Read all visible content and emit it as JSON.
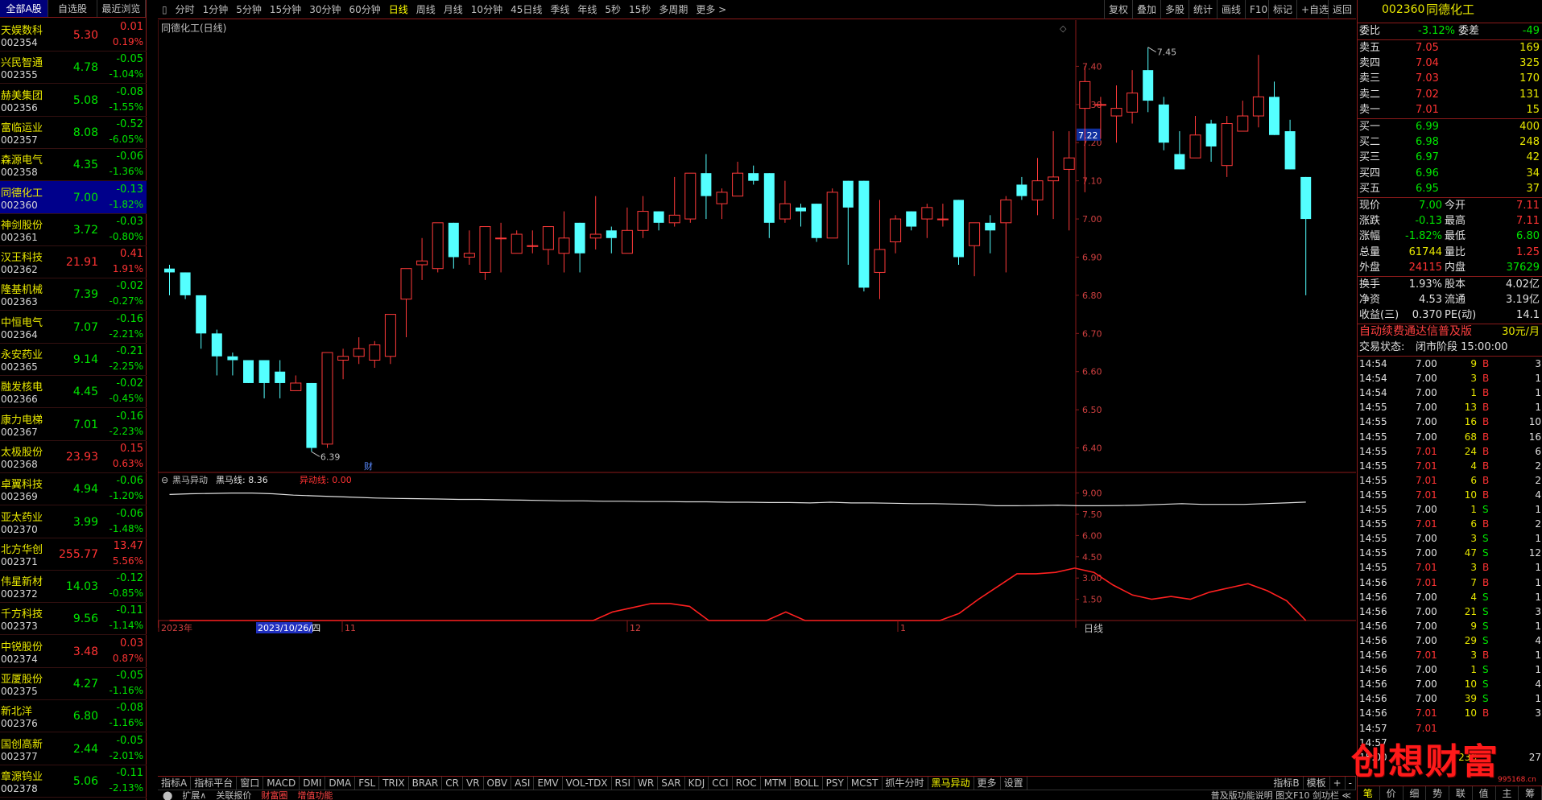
{
  "left_panel": {
    "tabs": [
      "全部A股",
      "自选股",
      "最近浏览"
    ],
    "stocks": [
      {
        "name": "天娱数科",
        "code": "002354",
        "price": "5.30",
        "change": "0.01",
        "pct": "0.19%",
        "dir": "up"
      },
      {
        "name": "兴民智通",
        "code": "002355",
        "price": "4.78",
        "change": "-0.05",
        "pct": "-1.04%",
        "dir": "dn"
      },
      {
        "name": "赫美集团",
        "code": "002356",
        "price": "5.08",
        "change": "-0.08",
        "pct": "-1.55%",
        "dir": "dn"
      },
      {
        "name": "富临运业",
        "code": "002357",
        "price": "8.08",
        "change": "-0.52",
        "pct": "-6.05%",
        "dir": "dn"
      },
      {
        "name": "森源电气",
        "code": "002358",
        "price": "4.35",
        "change": "-0.06",
        "pct": "-1.36%",
        "dir": "dn"
      },
      {
        "name": "同德化工",
        "code": "002360",
        "price": "7.00",
        "change": "-0.13",
        "pct": "-1.82%",
        "dir": "dn",
        "selected": true
      },
      {
        "name": "神剑股份",
        "code": "002361",
        "price": "3.72",
        "change": "-0.03",
        "pct": "-0.80%",
        "dir": "dn"
      },
      {
        "name": "汉王科技",
        "code": "002362",
        "price": "21.91",
        "change": "0.41",
        "pct": "1.91%",
        "dir": "up"
      },
      {
        "name": "隆基机械",
        "code": "002363",
        "price": "7.39",
        "change": "-0.02",
        "pct": "-0.27%",
        "dir": "dn"
      },
      {
        "name": "中恒电气",
        "code": "002364",
        "price": "7.07",
        "change": "-0.16",
        "pct": "-2.21%",
        "dir": "dn"
      },
      {
        "name": "永安药业",
        "code": "002365",
        "price": "9.14",
        "change": "-0.21",
        "pct": "-2.25%",
        "dir": "dn"
      },
      {
        "name": "融发核电",
        "code": "002366",
        "price": "4.45",
        "change": "-0.02",
        "pct": "-0.45%",
        "dir": "dn"
      },
      {
        "name": "康力电梯",
        "code": "002367",
        "price": "7.01",
        "change": "-0.16",
        "pct": "-2.23%",
        "dir": "dn"
      },
      {
        "name": "太极股份",
        "code": "002368",
        "price": "23.93",
        "change": "0.15",
        "pct": "0.63%",
        "dir": "up"
      },
      {
        "name": "卓翼科技",
        "code": "002369",
        "price": "4.94",
        "change": "-0.06",
        "pct": "-1.20%",
        "dir": "dn"
      },
      {
        "name": "亚太药业",
        "code": "002370",
        "price": "3.99",
        "change": "-0.06",
        "pct": "-1.48%",
        "dir": "dn"
      },
      {
        "name": "北方华创",
        "code": "002371",
        "price": "255.77",
        "change": "13.47",
        "pct": "5.56%",
        "dir": "up"
      },
      {
        "name": "伟星新材",
        "code": "002372",
        "price": "14.03",
        "change": "-0.12",
        "pct": "-0.85%",
        "dir": "dn"
      },
      {
        "name": "千方科技",
        "code": "002373",
        "price": "9.56",
        "change": "-0.11",
        "pct": "-1.14%",
        "dir": "dn"
      },
      {
        "name": "中锐股份",
        "code": "002374",
        "price": "3.48",
        "change": "0.03",
        "pct": "0.87%",
        "dir": "up"
      },
      {
        "name": "亚厦股份",
        "code": "002375",
        "price": "4.27",
        "change": "-0.05",
        "pct": "-1.16%",
        "dir": "dn"
      },
      {
        "name": "新北洋",
        "code": "002376",
        "price": "6.80",
        "change": "-0.08",
        "pct": "-1.16%",
        "dir": "dn"
      },
      {
        "name": "国创高新",
        "code": "002377",
        "price": "2.44",
        "change": "-0.05",
        "pct": "-2.01%",
        "dir": "dn"
      },
      {
        "name": "章源钨业",
        "code": "002378",
        "price": "5.06",
        "change": "-0.11",
        "pct": "-2.13%",
        "dir": "dn"
      }
    ]
  },
  "toolbar": {
    "periods": [
      "分时",
      "1分钟",
      "5分钟",
      "15分钟",
      "30分钟",
      "60分钟",
      "日线",
      "周线",
      "月线",
      "10分钟",
      "45日线",
      "季线",
      "年线",
      "5秒",
      "15秒",
      "多周期",
      "更多 >"
    ],
    "active_period": "日线",
    "right_buttons": [
      "复权",
      "叠加",
      "多股",
      "统计",
      "画线",
      "F10",
      "标记",
      "+自选",
      "返回"
    ]
  },
  "chart": {
    "title": "同德化工(日线)",
    "high_label": "7.45",
    "low_label": "6.39",
    "price_axis": [
      "7.40",
      "7.30",
      "7.20",
      "7.10",
      "7.00",
      "6.90",
      "6.80",
      "6.70",
      "6.60",
      "6.50",
      "6.40"
    ],
    "current_price_tag": "7.22",
    "cai_mark": "财",
    "indicator_name": "黑马异动",
    "indicator_line1": "黑马线: 8.36",
    "indicator_line2": "异动线: 0.00",
    "indicator_axis": [
      "9.00",
      "7.50",
      "6.00",
      "4.50",
      "3.00",
      "1.50"
    ],
    "date_labels": [
      "2023年",
      "2023/10/26/四",
      "11",
      "12",
      "1"
    ],
    "period_label": "日线",
    "cursor_date": "2023/10/26/四",
    "chart_data": {
      "type": "candlestick",
      "ylim": [
        6.34,
        7.5
      ],
      "candles": [
        [
          6.87,
          6.86,
          6.88,
          6.8
        ],
        [
          6.86,
          6.8,
          6.86,
          6.79
        ],
        [
          6.8,
          6.7,
          6.8,
          6.66
        ],
        [
          6.7,
          6.64,
          6.71,
          6.59
        ],
        [
          6.64,
          6.63,
          6.65,
          6.59
        ],
        [
          6.63,
          6.57,
          6.63,
          6.57
        ],
        [
          6.63,
          6.57,
          6.63,
          6.53
        ],
        [
          6.6,
          6.57,
          6.63,
          6.53
        ],
        [
          6.55,
          6.57,
          6.59,
          6.55
        ],
        [
          6.57,
          6.4,
          6.57,
          6.39
        ],
        [
          6.41,
          6.65,
          6.65,
          6.4
        ],
        [
          6.63,
          6.64,
          6.66,
          6.58
        ],
        [
          6.64,
          6.66,
          6.69,
          6.62
        ],
        [
          6.63,
          6.67,
          6.68,
          6.61
        ],
        [
          6.64,
          6.75,
          6.75,
          6.62
        ],
        [
          6.79,
          6.87,
          6.87,
          6.69
        ],
        [
          6.88,
          6.89,
          6.95,
          6.84
        ],
        [
          6.87,
          6.99,
          6.99,
          6.86
        ],
        [
          6.99,
          6.9,
          6.99,
          6.87
        ],
        [
          6.9,
          6.91,
          6.97,
          6.88
        ],
        [
          6.86,
          6.98,
          6.98,
          6.84
        ],
        [
          6.95,
          6.95,
          6.99,
          6.86
        ],
        [
          6.91,
          6.96,
          6.97,
          6.92
        ],
        [
          6.93,
          6.93,
          6.97,
          6.91
        ],
        [
          6.92,
          6.98,
          6.98,
          6.88
        ],
        [
          6.91,
          6.95,
          7.02,
          6.86
        ],
        [
          6.99,
          6.91,
          6.99,
          6.86
        ],
        [
          6.95,
          6.96,
          7.06,
          6.92
        ],
        [
          6.97,
          6.95,
          6.98,
          6.91
        ],
        [
          6.91,
          6.97,
          7.03,
          6.91
        ],
        [
          6.97,
          7.02,
          7.06,
          6.95
        ],
        [
          7.02,
          6.99,
          7.02,
          6.97
        ],
        [
          6.99,
          7.01,
          7.11,
          6.98
        ],
        [
          7.0,
          7.12,
          7.12,
          6.99
        ],
        [
          7.12,
          7.06,
          7.17,
          7.0
        ],
        [
          7.04,
          7.07,
          7.08,
          7.0
        ],
        [
          7.06,
          7.12,
          7.15,
          7.06
        ],
        [
          7.12,
          7.1,
          7.14,
          7.09
        ],
        [
          7.12,
          6.99,
          7.12,
          6.95
        ],
        [
          7.0,
          7.04,
          7.1,
          6.99
        ],
        [
          7.03,
          7.02,
          7.04,
          6.98
        ],
        [
          7.04,
          6.95,
          7.04,
          6.94
        ],
        [
          6.95,
          7.07,
          7.08,
          6.95
        ],
        [
          7.1,
          7.03,
          7.1,
          6.88
        ],
        [
          7.1,
          6.82,
          7.1,
          6.81
        ],
        [
          6.86,
          6.92,
          7.05,
          6.79
        ],
        [
          6.94,
          7.0,
          7.01,
          6.91
        ],
        [
          7.02,
          6.98,
          7.02,
          6.97
        ],
        [
          7.0,
          7.03,
          7.04,
          6.95
        ],
        [
          7.0,
          7.0,
          7.04,
          6.98
        ],
        [
          7.05,
          6.9,
          7.05,
          6.88
        ],
        [
          6.93,
          6.99,
          6.99,
          6.85
        ],
        [
          6.99,
          6.97,
          7.01,
          6.91
        ],
        [
          6.99,
          7.05,
          7.06,
          6.86
        ],
        [
          7.09,
          7.06,
          7.11,
          7.05
        ],
        [
          7.05,
          7.1,
          7.16,
          7.01
        ],
        [
          7.1,
          7.11,
          7.23,
          7.0
        ],
        [
          7.13,
          7.16,
          7.23,
          6.97
        ],
        [
          7.29,
          7.36,
          7.4,
          7.07
        ],
        [
          7.3,
          7.3,
          7.32,
          7.21
        ],
        [
          7.27,
          7.29,
          7.35,
          7.2
        ],
        [
          7.28,
          7.33,
          7.39,
          7.25
        ],
        [
          7.39,
          7.31,
          7.45,
          7.28
        ],
        [
          7.3,
          7.2,
          7.32,
          7.18
        ],
        [
          7.17,
          7.13,
          7.23,
          7.13
        ],
        [
          7.16,
          7.22,
          7.27,
          7.16
        ],
        [
          7.25,
          7.19,
          7.26,
          7.15
        ],
        [
          7.14,
          7.25,
          7.27,
          7.11
        ],
        [
          7.23,
          7.27,
          7.31,
          7.23
        ],
        [
          7.27,
          7.32,
          7.43,
          7.24
        ],
        [
          7.32,
          7.22,
          7.36,
          7.22
        ],
        [
          7.23,
          7.13,
          7.26,
          7.13
        ],
        [
          7.11,
          7.0,
          7.11,
          6.8
        ]
      ],
      "indicator_white": [
        8.9,
        8.95,
        8.97,
        9.0,
        9.0,
        8.95,
        8.85,
        8.8,
        8.75,
        8.7,
        8.65,
        8.62,
        8.6,
        8.58,
        8.55,
        8.55,
        8.52,
        8.5,
        8.48,
        8.45,
        8.45,
        8.42,
        8.42,
        8.4,
        8.4,
        8.38,
        8.38,
        8.35,
        8.35,
        8.33,
        8.33,
        8.3,
        8.35,
        8.3,
        8.3,
        8.28,
        8.25,
        8.25,
        8.22,
        8.2,
        8.1,
        8.1,
        8.12,
        8.15,
        8.1,
        8.1,
        8.12,
        8.15,
        8.2,
        8.25,
        8.2,
        8.2,
        8.2,
        8.25,
        8.3,
        8.36
      ],
      "indicator_red": [
        0,
        0,
        0,
        0,
        0,
        0,
        0,
        0,
        0,
        0,
        0,
        0,
        0,
        0,
        0,
        0,
        0,
        0,
        0,
        0,
        0,
        0,
        0,
        0.6,
        0.9,
        1.2,
        1.2,
        1.0,
        0,
        0,
        0,
        0,
        0.6,
        0,
        0,
        0,
        0,
        0,
        0,
        0,
        0,
        0.5,
        1.5,
        2.4,
        3.3,
        3.3,
        3.4,
        3.7,
        3.4,
        2.5,
        1.8,
        1.5,
        1.7,
        1.5,
        2.0,
        2.3,
        2.6,
        2.1,
        1.4,
        0
      ]
    }
  },
  "right_panel": {
    "code": "002360",
    "name": "同德化工",
    "weibi_label": "委比",
    "weibi": "-3.12%",
    "weicha_label": "委差",
    "weicha": "-49",
    "sells": [
      {
        "label": "卖五",
        "price": "7.05",
        "vol": "169"
      },
      {
        "label": "卖四",
        "price": "7.04",
        "vol": "325"
      },
      {
        "label": "卖三",
        "price": "7.03",
        "vol": "170"
      },
      {
        "label": "卖二",
        "price": "7.02",
        "vol": "131"
      },
      {
        "label": "卖一",
        "price": "7.01",
        "vol": "15"
      }
    ],
    "buys": [
      {
        "label": "买一",
        "price": "6.99",
        "vol": "400"
      },
      {
        "label": "买二",
        "price": "6.98",
        "vol": "248"
      },
      {
        "label": "买三",
        "price": "6.97",
        "vol": "42"
      },
      {
        "label": "买四",
        "price": "6.96",
        "vol": "34"
      },
      {
        "label": "买五",
        "price": "6.95",
        "vol": "37"
      }
    ],
    "quotes": [
      {
        "l1": "现价",
        "v1": "7.00",
        "c1": "dn",
        "l2": "今开",
        "v2": "7.11",
        "c2": "up"
      },
      {
        "l1": "涨跌",
        "v1": "-0.13",
        "c1": "dn",
        "l2": "最高",
        "v2": "7.11",
        "c2": "up"
      },
      {
        "l1": "涨幅",
        "v1": "-1.82%",
        "c1": "dn",
        "l2": "最低",
        "v2": "6.80",
        "c2": "dn"
      },
      {
        "l1": "总量",
        "v1": "61744",
        "c1": "yw",
        "l2": "量比",
        "v2": "1.25",
        "c2": "up"
      },
      {
        "l1": "外盘",
        "v1": "24115",
        "c1": "up",
        "l2": "内盘",
        "v2": "37629",
        "c2": "dn"
      }
    ],
    "stats": [
      {
        "l1": "换手",
        "v1": "1.93%",
        "l2": "股本",
        "v2": "4.02亿"
      },
      {
        "l1": "净资",
        "v1": "4.53",
        "l2": "流通",
        "v2": "3.19亿"
      },
      {
        "l1": "收益(三)",
        "v1": "0.370",
        "l2": "PE(动)",
        "v2": "14.1"
      }
    ],
    "promo": "自动续费通达信普及版",
    "promo_price": "30元/月",
    "trade_status_label": "交易状态:",
    "trade_status": "闭市阶段 15:00:00",
    "ticks": [
      {
        "t": "14:54",
        "p": "7.00",
        "v": "9",
        "d": "B",
        "n": "3"
      },
      {
        "t": "14:54",
        "p": "7.00",
        "v": "3",
        "d": "B",
        "n": "1"
      },
      {
        "t": "14:54",
        "p": "7.00",
        "v": "1",
        "d": "B",
        "n": "1"
      },
      {
        "t": "14:55",
        "p": "7.00",
        "v": "13",
        "d": "B",
        "n": "1"
      },
      {
        "t": "14:55",
        "p": "7.00",
        "v": "16",
        "d": "B",
        "n": "10"
      },
      {
        "t": "14:55",
        "p": "7.00",
        "v": "68",
        "d": "B",
        "n": "16"
      },
      {
        "t": "14:55",
        "p": "7.01",
        "v": "24",
        "d": "B",
        "n": "6"
      },
      {
        "t": "14:55",
        "p": "7.01",
        "v": "4",
        "d": "B",
        "n": "2"
      },
      {
        "t": "14:55",
        "p": "7.01",
        "v": "6",
        "d": "B",
        "n": "2"
      },
      {
        "t": "14:55",
        "p": "7.01",
        "v": "10",
        "d": "B",
        "n": "4"
      },
      {
        "t": "14:55",
        "p": "7.00",
        "v": "1",
        "d": "S",
        "n": "1"
      },
      {
        "t": "14:55",
        "p": "7.01",
        "v": "6",
        "d": "B",
        "n": "2"
      },
      {
        "t": "14:55",
        "p": "7.00",
        "v": "3",
        "d": "S",
        "n": "1"
      },
      {
        "t": "14:55",
        "p": "7.00",
        "v": "47",
        "d": "S",
        "n": "12"
      },
      {
        "t": "14:55",
        "p": "7.01",
        "v": "3",
        "d": "B",
        "n": "1"
      },
      {
        "t": "14:56",
        "p": "7.01",
        "v": "7",
        "d": "B",
        "n": "1"
      },
      {
        "t": "14:56",
        "p": "7.00",
        "v": "4",
        "d": "S",
        "n": "1"
      },
      {
        "t": "14:56",
        "p": "7.00",
        "v": "21",
        "d": "S",
        "n": "3"
      },
      {
        "t": "14:56",
        "p": "7.00",
        "v": "9",
        "d": "S",
        "n": "1"
      },
      {
        "t": "14:56",
        "p": "7.00",
        "v": "29",
        "d": "S",
        "n": "4"
      },
      {
        "t": "14:56",
        "p": "7.01",
        "v": "3",
        "d": "B",
        "n": "1"
      },
      {
        "t": "14:56",
        "p": "7.00",
        "v": "1",
        "d": "S",
        "n": "1"
      },
      {
        "t": "14:56",
        "p": "7.00",
        "v": "10",
        "d": "S",
        "n": "4"
      },
      {
        "t": "14:56",
        "p": "7.00",
        "v": "39",
        "d": "S",
        "n": "1"
      },
      {
        "t": "14:56",
        "p": "7.01",
        "v": "10",
        "d": "B",
        "n": "3"
      },
      {
        "t": "14:57",
        "p": "7.01",
        "v": "",
        "d": "",
        "n": ""
      },
      {
        "t": "14:57",
        "p": "",
        "v": "",
        "d": "",
        "n": ""
      },
      {
        "t": "15:00",
        "p": "",
        "v": "236",
        "d": "",
        "n": "27"
      }
    ],
    "bottom_tabs": [
      "笔",
      "价",
      "细",
      "势",
      "联",
      "值",
      "主",
      "筹"
    ]
  },
  "bottom_tabs": [
    "指标A",
    "指标平台",
    "窗口",
    "MACD",
    "DMI",
    "DMA",
    "FSL",
    "TRIX",
    "BRAR",
    "CR",
    "VR",
    "OBV",
    "ASI",
    "EMV",
    "VOL-TDX",
    "RSI",
    "WR",
    "SAR",
    "KDJ",
    "CCI",
    "ROC",
    "MTM",
    "BOLL",
    "PSY",
    "MCST",
    "抓牛分时",
    "黑马异动",
    "更多",
    "设置"
  ],
  "bottom_tabs_active": "黑马异动",
  "bottom_right_tabs": [
    "指标B",
    "模板",
    "+",
    "-"
  ],
  "status_bar": [
    "扩展∧",
    "关联报价",
    "财富圈",
    "增值功能"
  ],
  "status_right": "普及版功能说明 图文F10 剑功栏 ≪",
  "watermark": "创想财富",
  "watermark_sub": "995168.cn"
}
